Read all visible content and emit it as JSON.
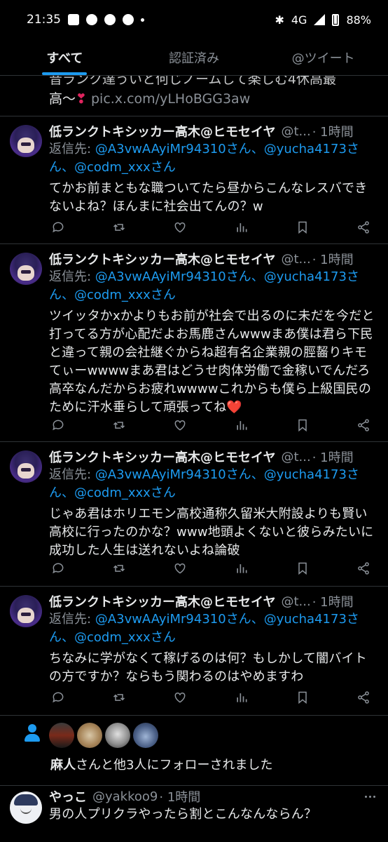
{
  "status_bar": {
    "time": "21:35",
    "network": "4G",
    "battery": "88%",
    "icons": [
      "photo-icon",
      "chat-icon",
      "facebook-icon",
      "facebook-icon",
      "dot-icon",
      "bluetooth-icon",
      "signal-icon",
      "battery-icon"
    ]
  },
  "tabs": [
    {
      "label": "すべて",
      "active": true
    },
    {
      "label": "認証済み",
      "active": false
    },
    {
      "label": "@ツイート",
      "active": false
    }
  ],
  "partial_tweet": {
    "cut_line": "音ランク達ういと何じノームして楽しむ4休高最",
    "text": "高〜",
    "link": "pic.x.com/yLHoBGG3aw"
  },
  "tweets": [
    {
      "name": "低ランクトキシッカー高木@ヒモセイヤ",
      "handle": "@t...",
      "time": "· 1時間",
      "reply_prefix": "返信先: ",
      "mention1": "@A3vwAAyiMr94310さん",
      "sep": "、",
      "mention2": "@yucha4173さん",
      "mention3": "@codm_xxxさん",
      "text": "てかお前まともな職ついてたら昼からこんなレスバできないよね？ほんまに社会出てんの？w",
      "heart": ""
    },
    {
      "name": "低ランクトキシッカー高木@ヒモセイヤ",
      "handle": "@t...",
      "time": "· 1時間",
      "reply_prefix": "返信先: ",
      "mention1": "@A3vwAAyiMr94310さん",
      "sep": "、",
      "mention2": "@yucha4173さん",
      "mention3": "@codm_xxxさん",
      "text": "ツイッタかxかよりもお前が社会で出るのに未だを今だと打ってる方が心配だよお馬鹿さんwwwまあ僕は君ら下民と違って親の会社継ぐからね超有名企業親の脛齧りキモてぃーwwwwまあ君はどうせ肉体労働で金稼いでんだろ高卒なんだからお疲れwwwwこれからも僕ら上級国民のために汗水垂らして頑張ってね",
      "heart": "❤️"
    },
    {
      "name": "低ランクトキシッカー高木@ヒモセイヤ",
      "handle": "@t...",
      "time": "· 1時間",
      "reply_prefix": "返信先: ",
      "mention1": "@A3vwAAyiMr94310さん",
      "sep": "、",
      "mention2": "@yucha4173さん",
      "mention3": "@codm_xxxさん",
      "text": "じゃあ君はホリエモン高校通称久留米大附設よりも賢い高校に行ったのかな？www地頭よくないと彼らみたいに成功した人生は送れないよね論破",
      "heart": ""
    },
    {
      "name": "低ランクトキシッカー高木@ヒモセイヤ",
      "handle": "@t...",
      "time": "· 1時間",
      "reply_prefix": "返信先: ",
      "mention1": "@A3vwAAyiMr94310さん",
      "sep": "、",
      "mention2": "@yucha4173さん",
      "mention3": "@codm_xxxさん",
      "text": "ちなみに学がなくて稼げるのは何？もしかして闇バイトの方ですか？ならもう関わるのはやめますわ",
      "heart": ""
    }
  ],
  "follow_notice": {
    "name": "麻人",
    "text": "さんと他3人にフォローされました"
  },
  "last_tweet": {
    "name": "やっこ",
    "handle": "@yakkoo9",
    "time": "· 1時間",
    "text": "男の人プリクラやったら割とこんなんならん？"
  },
  "colors": {
    "background": "#000000",
    "text": "#e7e9ea",
    "secondary": "#8b9198",
    "accent": "#1d9bf0",
    "heart": "#e0245e",
    "divider": "#2f3336"
  }
}
